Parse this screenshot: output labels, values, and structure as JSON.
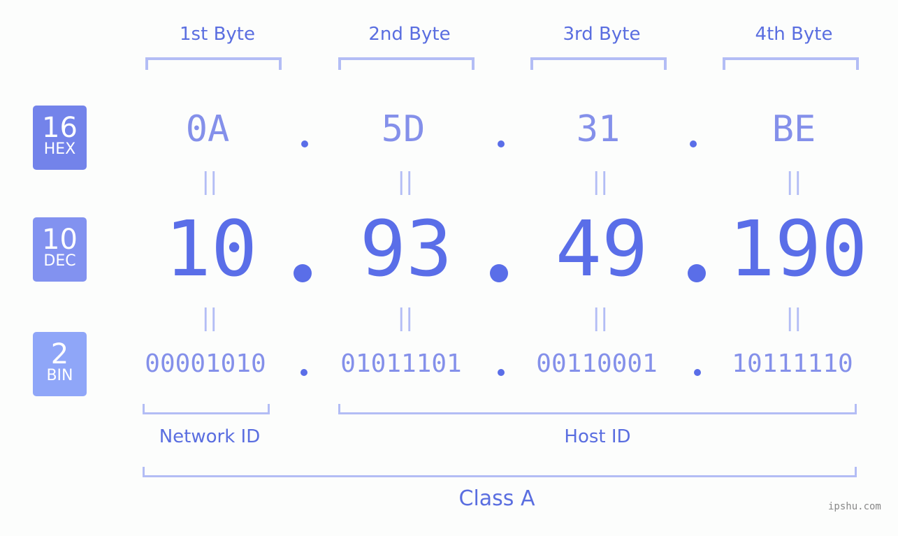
{
  "bytes": [
    {
      "label": "1st Byte",
      "hex": "0A",
      "dec": "10",
      "bin": "00001010"
    },
    {
      "label": "2nd Byte",
      "hex": "5D",
      "dec": "93",
      "bin": "01011101"
    },
    {
      "label": "3rd Byte",
      "hex": "31",
      "dec": "49",
      "bin": "00110001"
    },
    {
      "label": "4th Byte",
      "hex": "BE",
      "dec": "190",
      "bin": "10111110"
    }
  ],
  "bases": {
    "hex": {
      "num": "16",
      "label": "HEX",
      "color": "#7383ea"
    },
    "dec": {
      "num": "10",
      "label": "DEC",
      "color": "#8292f0"
    },
    "bin": {
      "num": "2",
      "label": "BIN",
      "color": "#8fa6f8"
    }
  },
  "separator": ".",
  "equals": "||",
  "network_label": "Network ID",
  "host_label": "Host ID",
  "class_label": "Class A",
  "site": "ipshu.com",
  "colors": {
    "accent": "#5a6ee8",
    "light": "#b3bdf5",
    "mid": "#8490ea"
  }
}
